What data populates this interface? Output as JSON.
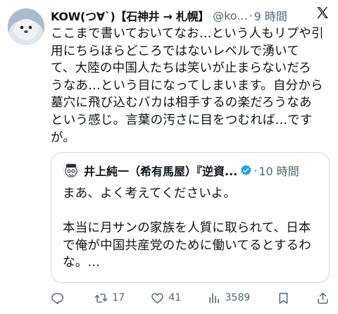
{
  "tweet": {
    "author_name": "KOW(つ∀`)【石神井 → 札幌】",
    "author_handle": "@ko...",
    "separator": "·",
    "time": "9 時間",
    "lines": [
      "ここまで書いておいてなお…という人もリプや引",
      "用にちらほらどころではないレベルで湧いて",
      "て、大陸の中国人たちは笑いが止まらないだろ",
      "うなあ…という目になってしまいます。自分から",
      "墓穴に飛び込むバカは相手するの楽だろうなあ",
      "という感じ。言葉の汚さに目をつむれば…です",
      "が。"
    ]
  },
  "quote": {
    "author_name": "井上純一（希有馬屋）『逆資...",
    "separator": "·",
    "time": "10 時間",
    "lines": [
      "まあ、よく考えてくださいよ。",
      "",
      "本当に月サンの家族を人質に取られて、日本",
      "で俺が中国共産党のために働いてるとするわ",
      "な。…"
    ]
  },
  "actions": {
    "reply": "",
    "retweet": "17",
    "like": "41",
    "views": "3589"
  },
  "colors": {
    "text": "#0f1419",
    "muted": "#536471",
    "border": "#cfd9de",
    "verified": "#1d9bf0"
  },
  "icons": [
    "seal-avatar",
    "x-logo-icon",
    "cartoon-avatar",
    "verified-badge-icon",
    "reply-icon",
    "retweet-icon",
    "like-icon",
    "views-icon",
    "bookmark-icon",
    "share-icon"
  ]
}
